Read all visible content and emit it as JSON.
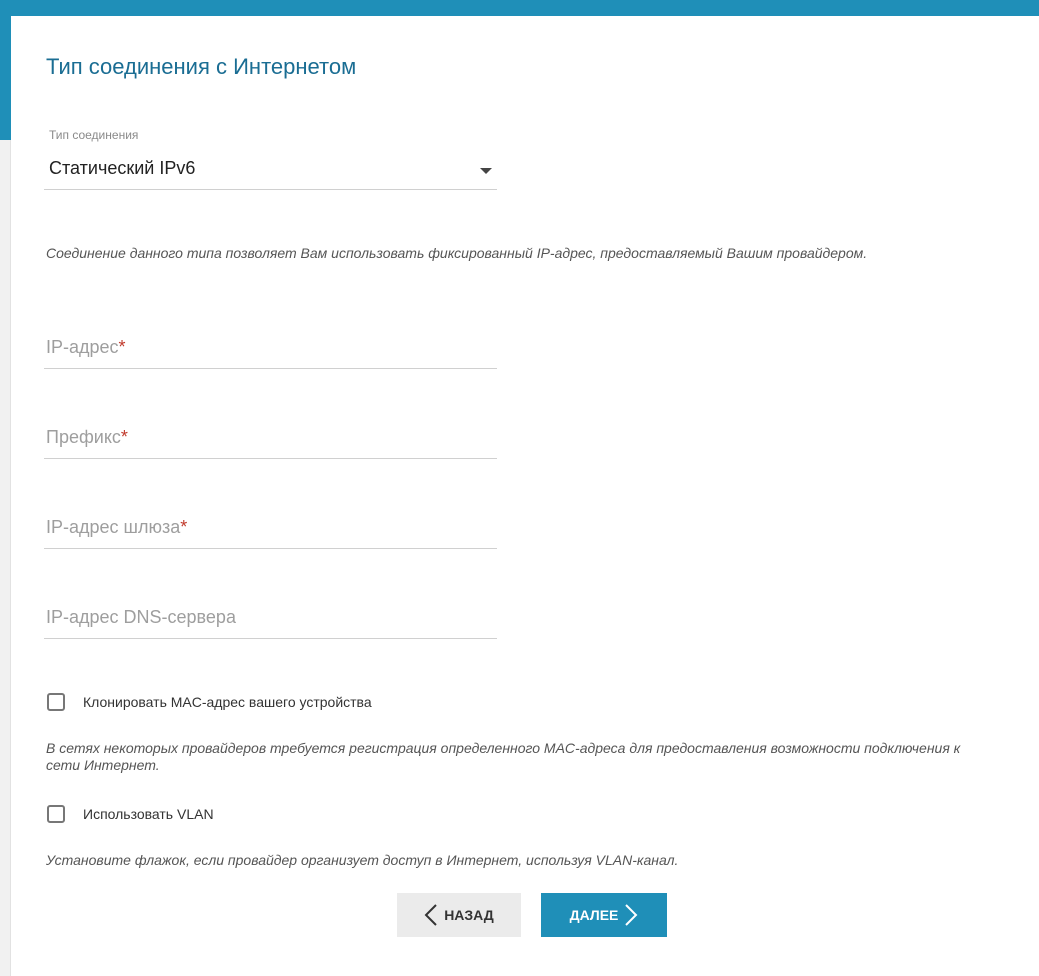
{
  "page": {
    "title": "Тип соединения с Интернетом"
  },
  "connection_type": {
    "caption": "Тип соединения",
    "selected": "Статический IPv6",
    "description": "Соединение данного типа позволяет Вам использовать фиксированный IP-адрес, предоставляемый Вашим провайдером."
  },
  "fields": {
    "ip_address": {
      "label": "IP-адрес",
      "required_mark": "*",
      "value": ""
    },
    "prefix": {
      "label": "Префикс",
      "required_mark": "*",
      "value": ""
    },
    "gateway": {
      "label": "IP-адрес шлюза",
      "required_mark": "*",
      "value": ""
    },
    "dns": {
      "label": "IP-адрес DNS-сервера",
      "value": ""
    }
  },
  "options": {
    "clone_mac": {
      "label": "Клонировать MAC-адрес вашего устройства",
      "checked": false,
      "hint": "В сетях некоторых провайдеров требуется регистрация определенного MAC-адреса для предоставления возможности подключения к сети Интернет."
    },
    "use_vlan": {
      "label": "Использовать VLAN",
      "checked": false,
      "hint": "Установите флажок, если провайдер организует доступ в Интернет, используя VLAN-канал."
    }
  },
  "buttons": {
    "back": "НАЗАД",
    "next": "ДАЛЕЕ"
  },
  "colors": {
    "accent": "#1f8fb8",
    "title": "#1a6d93",
    "required": "#c0392b"
  }
}
